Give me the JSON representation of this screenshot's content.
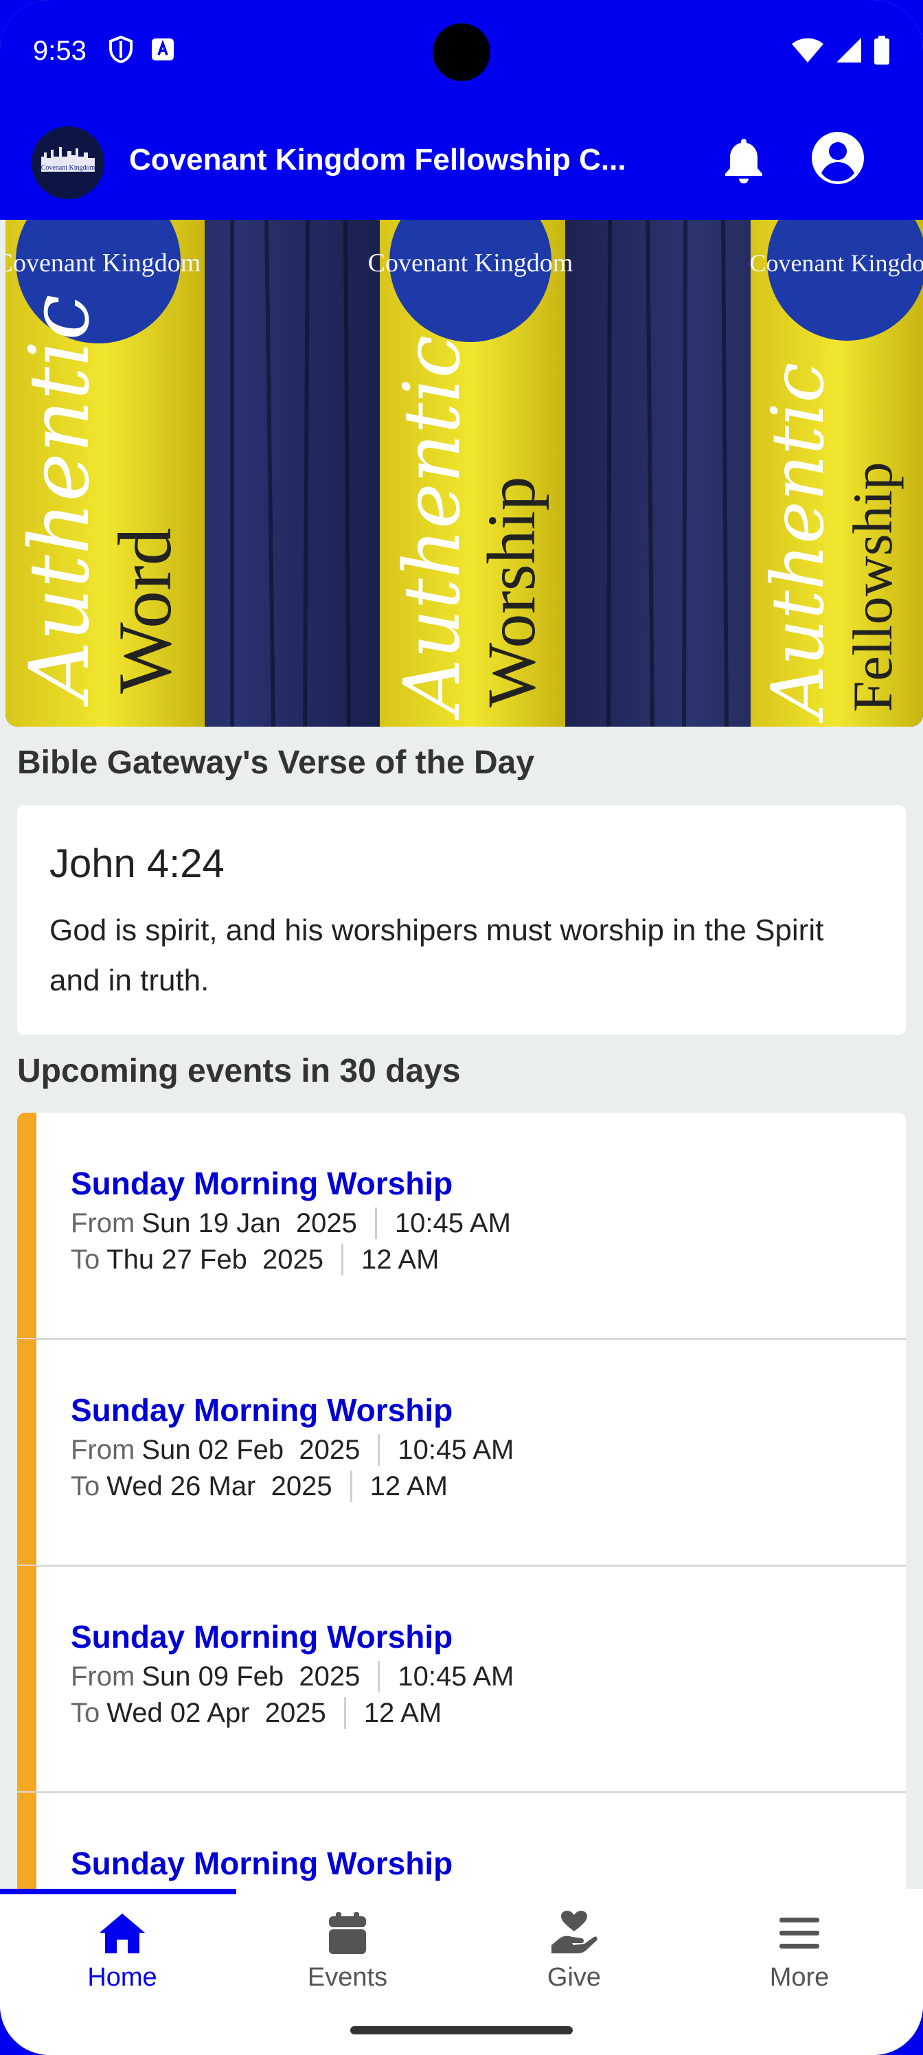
{
  "status_bar": {
    "time": "9:53"
  },
  "app_bar": {
    "title": "Covenant Kingdom Fellowship C...",
    "logo_text": "Covenant Kingdom"
  },
  "hero": {
    "banners": [
      {
        "logo": "Covenant Kingdom",
        "script": "Authentic",
        "word": "Word"
      },
      {
        "logo": "Covenant Kingdom",
        "script": "Authentic",
        "word": "Worship"
      },
      {
        "logo": "Covenant Kingdom",
        "script": "Authentic",
        "word": "Fellowship"
      }
    ]
  },
  "verse_section": {
    "title": "Bible Gateway's Verse of the Day",
    "reference": "John 4:24",
    "text": "God is spirit, and his worshipers must worship in the Spirit and in truth."
  },
  "events_section": {
    "title": "Upcoming events in 30 days",
    "from_label": "From",
    "to_label": "To",
    "items": [
      {
        "title": "Sunday Morning Worship",
        "from_date": "Sun 19 Jan  2025",
        "from_time": "10:45 AM",
        "to_date": "Thu 27 Feb  2025",
        "to_time": "12 AM"
      },
      {
        "title": "Sunday Morning Worship",
        "from_date": "Sun 02 Feb  2025",
        "from_time": "10:45 AM",
        "to_date": "Wed 26 Mar  2025",
        "to_time": "12 AM"
      },
      {
        "title": "Sunday Morning Worship",
        "from_date": "Sun 09 Feb  2025",
        "from_time": "10:45 AM",
        "to_date": "Wed 02 Apr  2025",
        "to_time": "12 AM"
      },
      {
        "title": "Sunday Morning Worship"
      }
    ]
  },
  "bottom_nav": {
    "items": [
      {
        "label": "Home",
        "icon": "home-icon",
        "active": true
      },
      {
        "label": "Events",
        "icon": "calendar-icon"
      },
      {
        "label": "Give",
        "icon": "give-hand-heart-icon"
      },
      {
        "label": "More",
        "icon": "menu-icon"
      }
    ]
  },
  "colors": {
    "primary": "#0000ee",
    "accent": "#f5a623",
    "event_title": "#0000d6",
    "background": "#eaeeed"
  }
}
